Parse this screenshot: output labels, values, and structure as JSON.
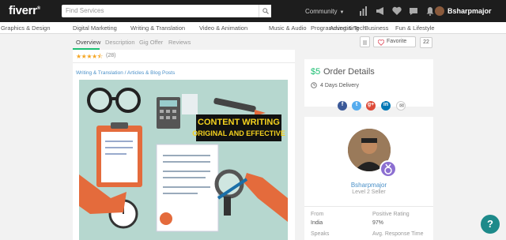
{
  "header": {
    "logo": "fiverr",
    "logo_mark": "®",
    "search_placeholder": "Find Services",
    "community_label": "Community",
    "username": "Bsharpmajor",
    "icons": [
      "stats-icon",
      "megaphone-icon",
      "heart-icon",
      "chat-icon",
      "bell-icon"
    ]
  },
  "categories": [
    "Graphics & Design",
    "Digital Marketing",
    "Writing & Translation",
    "Video & Animation",
    "Music & Audio",
    "Programming & Tech",
    "Advertising",
    "Business",
    "Fun & Lifestyle"
  ],
  "tabs": [
    "Overview",
    "Description",
    "Gig Offer",
    "Reviews"
  ],
  "favorite": {
    "label": "Favorite",
    "count": "22"
  },
  "rating": {
    "stars": 4.5,
    "count": "(28)"
  },
  "breadcrumb": "Writing & Translation / Articles & Blog Posts",
  "gig_image": {
    "line1": "CONTENT WRITING",
    "line2": "ORIGINAL AND EFFECTIVE"
  },
  "order": {
    "price": "$5",
    "label": "Order Details",
    "delivery": "4 Days Delivery"
  },
  "share": [
    "facebook-icon",
    "twitter-icon",
    "google-plus-icon",
    "linkedin-icon",
    "email-icon"
  ],
  "seller": {
    "name": "Bsharpmajor",
    "level": "Level 2 Seller",
    "from_label": "From",
    "from_value": "India",
    "rating_label": "Positive Rating",
    "rating_value": "97%",
    "speaks_label": "Speaks",
    "response_label": "Avg. Response Time"
  },
  "help_label": "?",
  "colors": {
    "brand_green": "#1dbf73",
    "topbar": "#1d1d1d",
    "link_blue": "#4a90c8"
  }
}
